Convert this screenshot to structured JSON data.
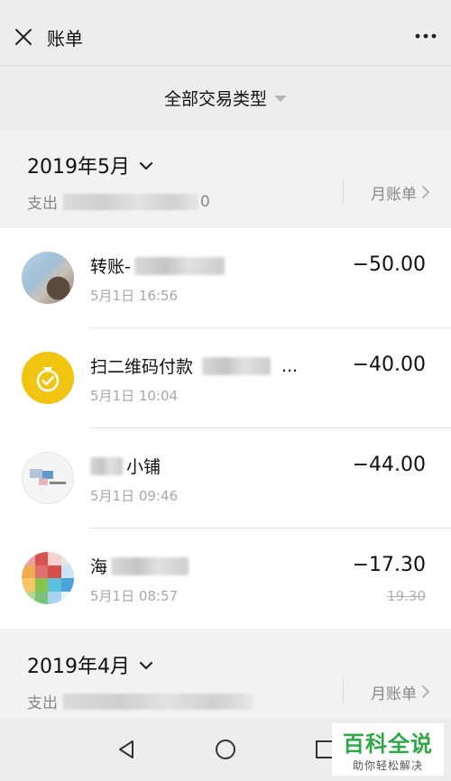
{
  "header": {
    "title": "账单"
  },
  "filter": {
    "label": "全部交易类型"
  },
  "months": [
    {
      "label": "2019年5月",
      "summary_prefix": "支出",
      "summary_tail": "0",
      "bill_link": "月账单",
      "transactions": [
        {
          "name": "转账-",
          "time": "5月1日 16:56",
          "amount": "−50.00",
          "avatar": "person"
        },
        {
          "name": "扫二维码付款",
          "name_suffix": "...",
          "time": "5月1日 10:04",
          "amount": "−40.00",
          "avatar": "gold"
        },
        {
          "name": "小铺",
          "time": "5月1日 09:46",
          "amount": "−44.00",
          "avatar": "shop"
        },
        {
          "name": "海",
          "time": "5月1日 08:57",
          "amount": "−17.30",
          "original": "19.30",
          "avatar": "mosaic"
        }
      ]
    },
    {
      "label": "2019年4月",
      "summary_prefix": "支出",
      "bill_link": "月账单"
    }
  ],
  "watermark": {
    "main": "百科全说",
    "sub": "助你轻松解决"
  },
  "colors": {
    "background": "#ededed",
    "card": "#ffffff",
    "gold": "#f1c40f",
    "watermark_green": "#2ea845"
  }
}
